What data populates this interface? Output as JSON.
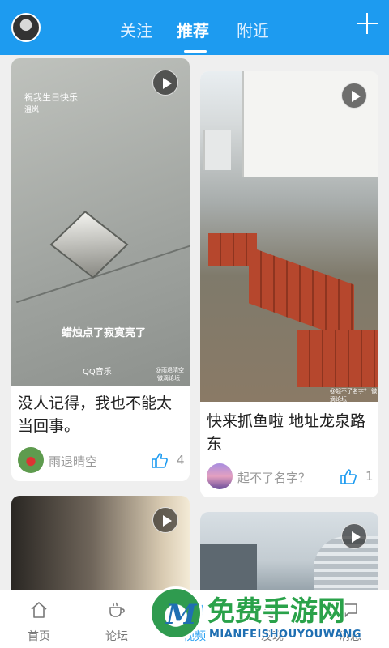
{
  "header": {
    "tabs": [
      {
        "label": "关注",
        "active": false
      },
      {
        "label": "推荐",
        "active": true
      },
      {
        "label": "附近",
        "active": false
      }
    ],
    "accent_color": "#1d9bf0"
  },
  "feed": {
    "cards": [
      {
        "overlay_top_line1": "祝我生日快乐",
        "overlay_top_line2": "温岚",
        "overlay_caption": "蜡烛点了寂寞亮了",
        "overlay_music": "QQ音乐",
        "overlay_watermark1": "@雨退晴空",
        "overlay_watermark2": "微滴论坛",
        "title": "没人记得，我也不能太当回事。",
        "author": "雨退晴空",
        "likes": "4"
      },
      {
        "overlay_watermark": "@起不了名字？ 微滴论坛",
        "title": "快来抓鱼啦 地址龙泉路东",
        "author": "起不了名字？",
        "likes": "1"
      },
      {
        "title": ""
      },
      {
        "title": ""
      }
    ]
  },
  "bottom_nav": {
    "items": [
      {
        "label": "首页",
        "icon": "home-icon"
      },
      {
        "label": "论坛",
        "icon": "coffee-cup-icon"
      },
      {
        "label": "视频",
        "icon": "video-icon"
      },
      {
        "label": "发现",
        "icon": "discover-icon"
      },
      {
        "label": "消息",
        "icon": "message-icon"
      }
    ]
  },
  "watermark": {
    "cn": "免费手游网",
    "en": "MIANFEISHOUYOUWANG",
    "logo_letter": "M"
  }
}
